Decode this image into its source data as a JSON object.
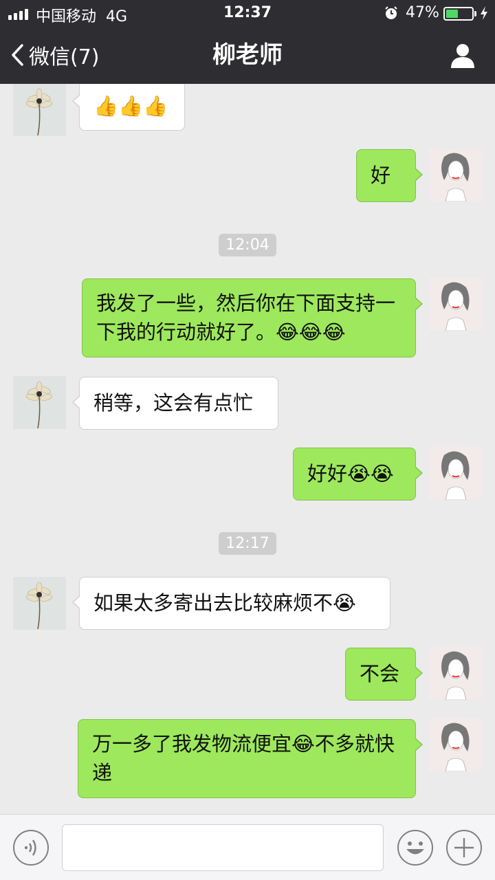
{
  "status_bar": {
    "carrier": "中国移动",
    "network": "4G",
    "time": "12:37",
    "battery": "47%",
    "battery_level": 0.47
  },
  "nav": {
    "back_label": "微信(7)",
    "title": "柳老师"
  },
  "messages": [
    {
      "side": "in",
      "text": "👍👍👍"
    },
    {
      "side": "out",
      "text": "好"
    },
    {
      "type": "time",
      "text": "12:04"
    },
    {
      "side": "out",
      "text": "我发了一些，然后你在下面支持一下我的行动就好了。😂😂😂"
    },
    {
      "side": "in",
      "text": "稍等，这会有点忙"
    },
    {
      "side": "out",
      "text": "好好😭😭"
    },
    {
      "type": "time",
      "text": "12:17"
    },
    {
      "side": "in",
      "text": "如果太多寄出去比较麻烦不😭"
    },
    {
      "side": "out",
      "text": "不会"
    },
    {
      "side": "out",
      "text": "万一多了我发物流便宜😂不多就快递"
    }
  ],
  "input_bar": {
    "placeholder": ""
  },
  "icons": {
    "back": "chevron-left-icon",
    "profile": "person-icon",
    "voice": "voice-icon",
    "emoji": "smiley-icon",
    "more": "plus-icon",
    "alarm": "alarm-icon",
    "charging": "bolt-icon"
  },
  "colors": {
    "nav_bg": "#2e2e32",
    "chat_bg": "#ebebeb",
    "outgoing_bubble": "#9de85c",
    "incoming_bubble": "#ffffff",
    "battery_fill": "#4cd964"
  }
}
